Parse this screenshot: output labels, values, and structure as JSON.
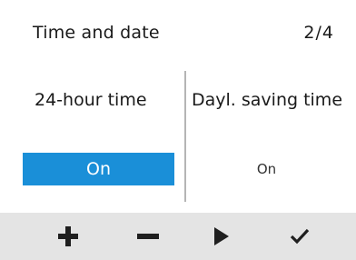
{
  "header": {
    "title": "Time and date",
    "page_indicator": "2/4"
  },
  "settings": [
    {
      "label": "24-hour time",
      "value": "On",
      "selected": true
    },
    {
      "label": "Dayl. saving time",
      "value": "On",
      "selected": false
    }
  ],
  "footer": {
    "buttons": [
      {
        "icon": "plus-icon"
      },
      {
        "icon": "minus-icon"
      },
      {
        "icon": "play-icon"
      },
      {
        "icon": "checkmark-icon"
      }
    ]
  },
  "colors": {
    "selection": "#1a8fd8",
    "footer_bg": "#e4e4e4",
    "divider": "#b5b5b5"
  }
}
